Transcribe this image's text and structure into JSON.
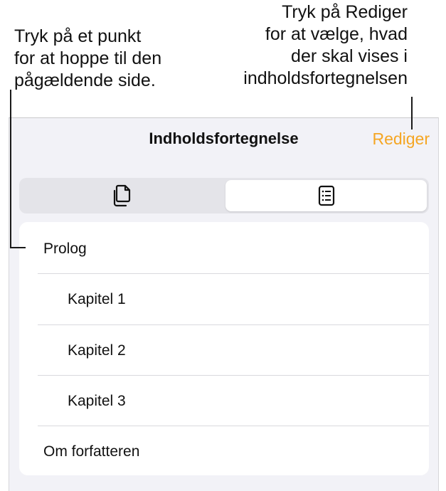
{
  "callouts": {
    "left": [
      "Tryk på et punkt",
      "for at hoppe til den",
      "pågældende side."
    ],
    "right": [
      "Tryk på Rediger",
      "for at vælge, hvad",
      "der skal vises i",
      "indholdsfortegnelsen"
    ]
  },
  "nav": {
    "title": "Indholdsfortegnelse",
    "edit_label": "Rediger"
  },
  "segments": [
    {
      "icon": "pages-icon",
      "selected": false
    },
    {
      "icon": "table-of-contents-icon",
      "selected": true
    }
  ],
  "toc": {
    "items": [
      {
        "label": "Prolog",
        "level": 0
      },
      {
        "label": "Kapitel 1",
        "level": 1
      },
      {
        "label": "Kapitel 2",
        "level": 1
      },
      {
        "label": "Kapitel 3",
        "level": 1
      },
      {
        "label": "Om forfatteren",
        "level": 0
      }
    ]
  },
  "colors": {
    "accent": "#f5a623",
    "panel_background": "#f2f2f7",
    "segment_track": "#e4e4e9"
  }
}
